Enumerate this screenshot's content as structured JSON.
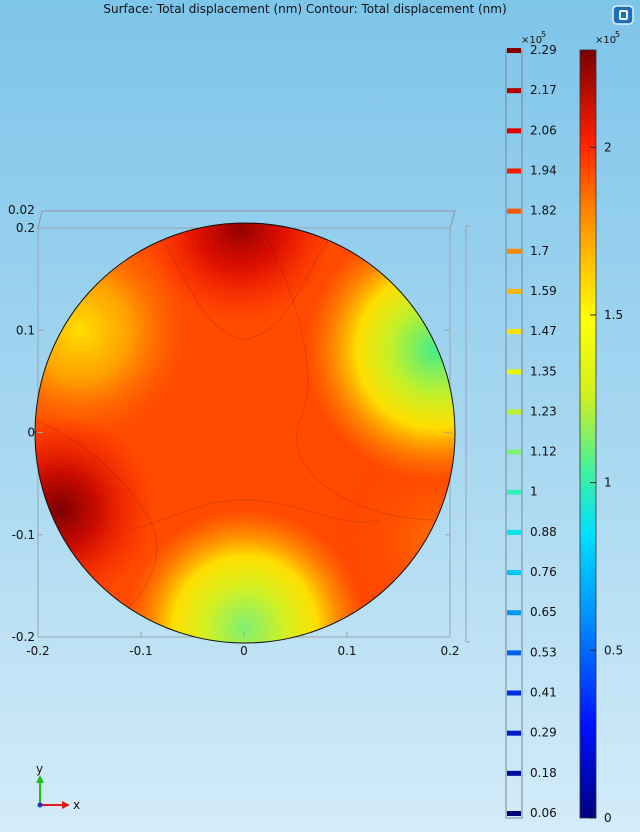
{
  "chart_data": {
    "type": "heatmap",
    "title": "Surface: Total displacement (nm)  Contour: Total displacement (nm)",
    "x_ticks": [
      "-0.2",
      "-0.1",
      "0",
      "0.1",
      "0.2"
    ],
    "y_ticks": [
      "0.2",
      "0.1",
      "0",
      "-0.1",
      "-0.2"
    ],
    "xlim": [
      -0.2,
      0.2
    ],
    "ylim": [
      -0.2,
      0.2
    ],
    "corner_label": "0.02",
    "contour_legend": {
      "multiplier": "×10",
      "exponent": "5",
      "levels": [
        "2.29",
        "2.17",
        "2.06",
        "1.94",
        "1.82",
        "1.7",
        "1.59",
        "1.47",
        "1.35",
        "1.23",
        "1.12",
        "1",
        "0.88",
        "0.76",
        "0.65",
        "0.53",
        "0.41",
        "0.29",
        "0.18",
        "0.06"
      ],
      "level_colors": [
        "#800000",
        "#b00000",
        "#e00000",
        "#f01a00",
        "#f55a00",
        "#fa8a00",
        "#ffb400",
        "#ffe400",
        "#eaf500",
        "#bbf22a",
        "#7ef272",
        "#30f0b4",
        "#00e5ea",
        "#00c8f5",
        "#0096f5",
        "#0060f0",
        "#0030e6",
        "#001cc8",
        "#000ea0",
        "#000078"
      ]
    },
    "colorbar": {
      "multiplier": "×10",
      "exponent": "5",
      "range": [
        0,
        2.29
      ],
      "tick_values": [
        0,
        0.5,
        1,
        1.5,
        2
      ],
      "tick_labels": [
        "0",
        "0.5",
        "1",
        "1.5",
        "2"
      ]
    },
    "axis_triad": {
      "x": "x",
      "y": "y"
    },
    "color_stops": [
      [
        0.0,
        "#000080"
      ],
      [
        0.12,
        "#0010ff"
      ],
      [
        0.26,
        "#0090ff"
      ],
      [
        0.37,
        "#00e0ff"
      ],
      [
        0.45,
        "#40f0a0"
      ],
      [
        0.55,
        "#d0f020"
      ],
      [
        0.65,
        "#ffff00"
      ],
      [
        0.78,
        "#ff9000"
      ],
      [
        0.88,
        "#ff2000"
      ],
      [
        1.0,
        "#7a0000"
      ]
    ]
  }
}
